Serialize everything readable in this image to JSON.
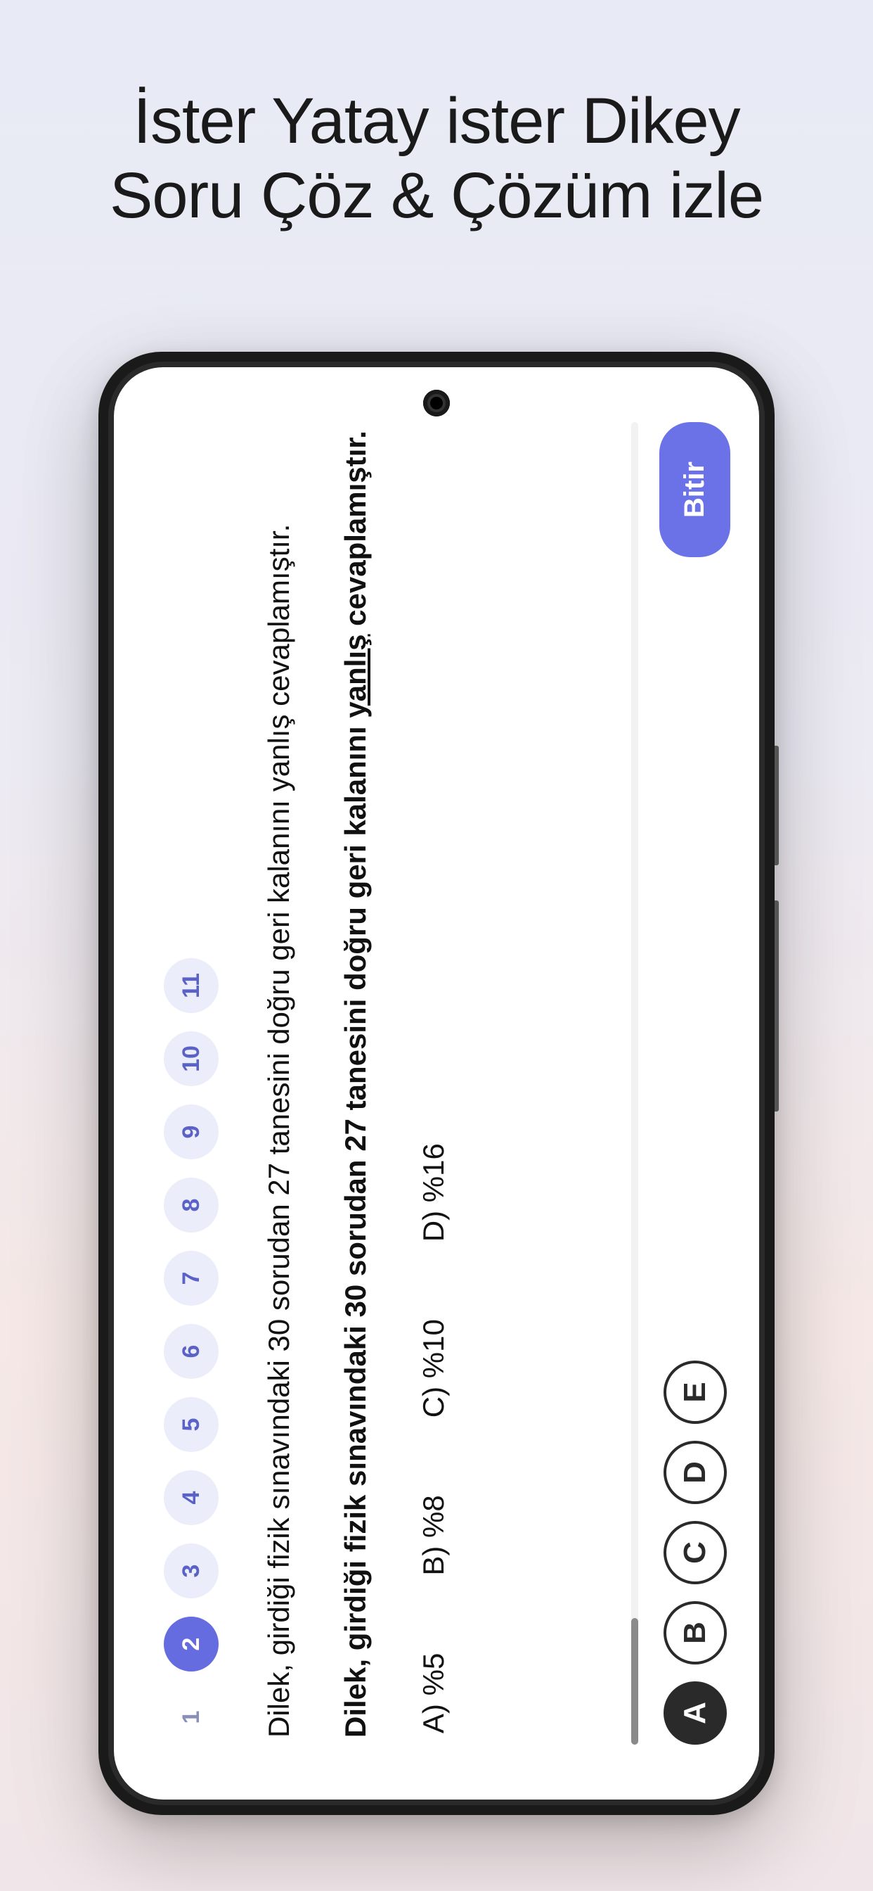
{
  "headline": {
    "line1": "İster Yatay ister Dikey",
    "line2": "Soru Çöz & Çözüm izle"
  },
  "questionNumbers": [
    "1",
    "2",
    "3",
    "4",
    "5",
    "6",
    "7",
    "8",
    "9",
    "10",
    "11"
  ],
  "activeQuestionIndex": 1,
  "question": {
    "text_normal": "Dilek, girdiği fizik sınavındaki 30 sorudan 27 tanesini doğru geri kalanını yanlış cevaplamıştır.",
    "text_bold_prefix": "Dilek, girdiği fizik sınavındaki 30 sorudan 27 tanesini doğru geri kalanını ",
    "text_bold_underline": "yanlış",
    "text_bold_suffix": " cevaplamıştır."
  },
  "answers": {
    "a": "A) %5",
    "b": "B) %8",
    "c": "C) %10",
    "d": "D) %16"
  },
  "choices": [
    "A",
    "B",
    "C",
    "D",
    "E"
  ],
  "selectedChoiceIndex": 0,
  "finishLabel": "Bitir"
}
